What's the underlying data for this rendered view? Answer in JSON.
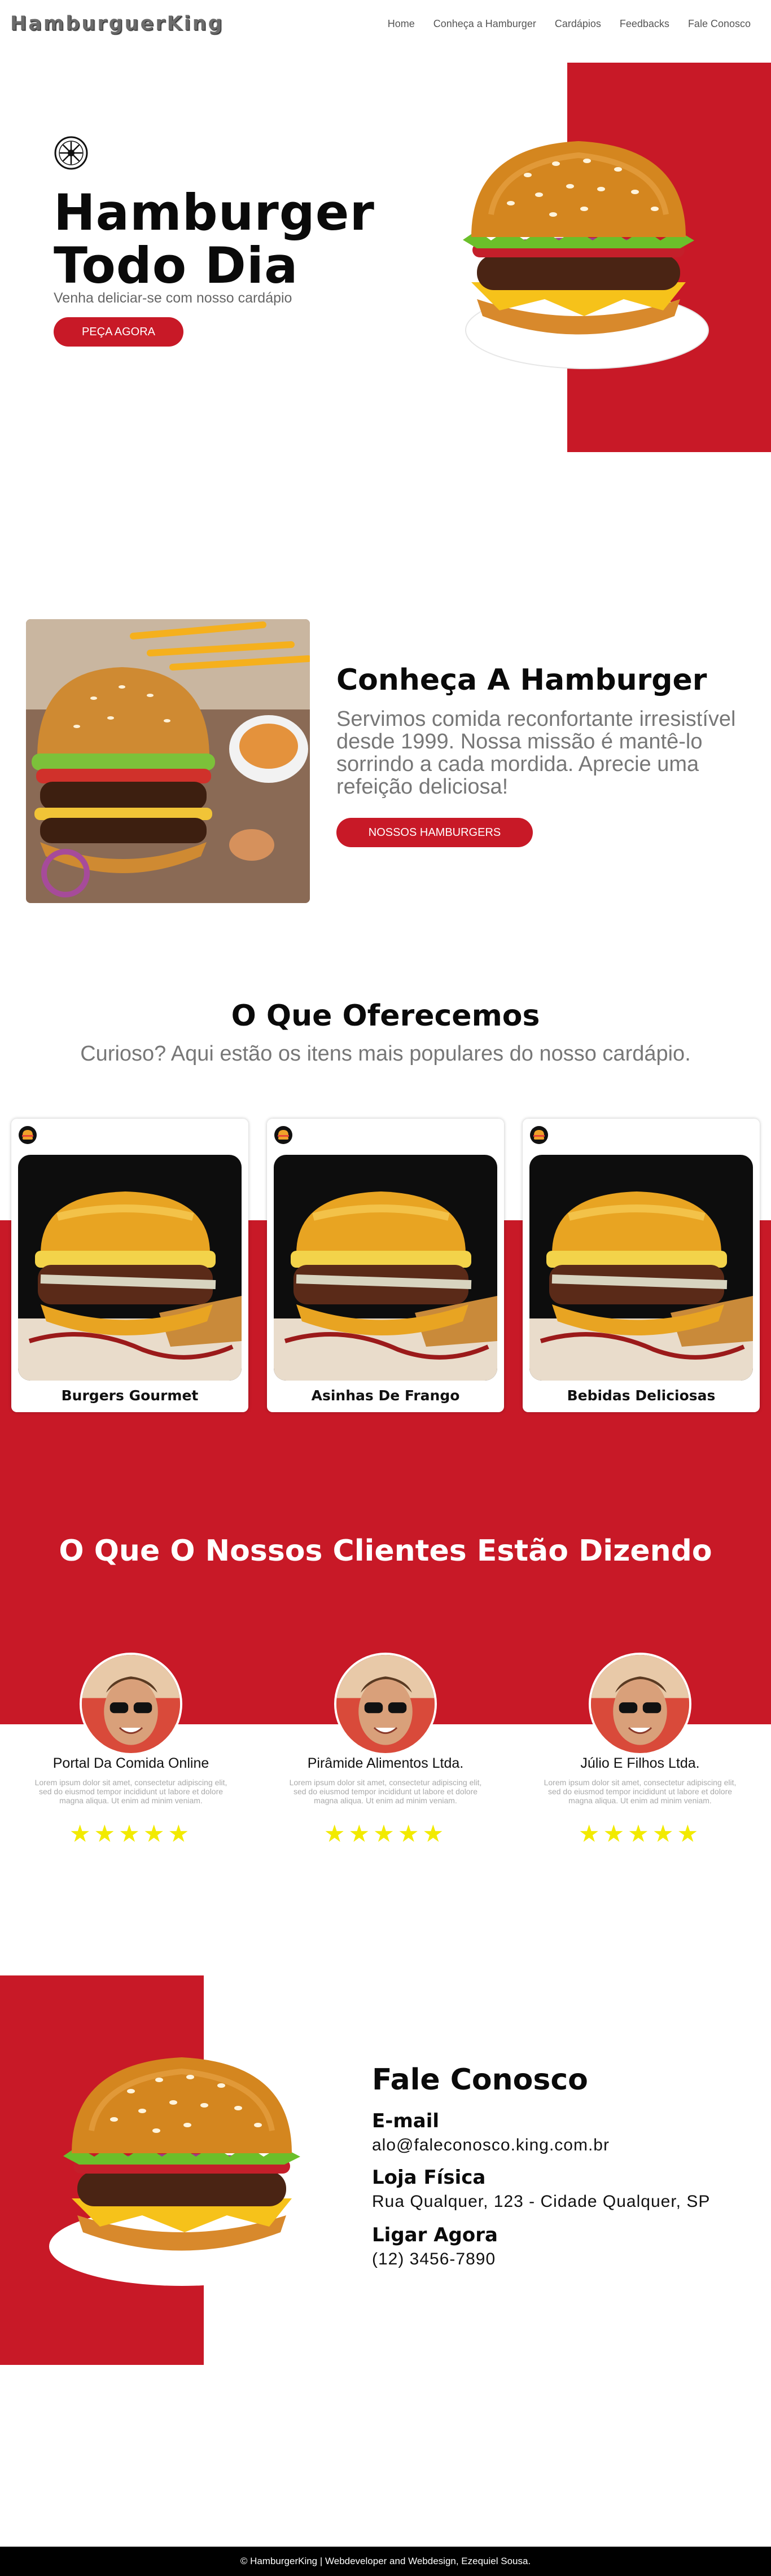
{
  "header": {
    "logo": "HamburguerKing",
    "nav": [
      "Home",
      "Conheça a Hamburger",
      "Cardápios",
      "Feedbacks",
      "Fale Conosco"
    ]
  },
  "hero": {
    "badge_icon": "emblem-icon",
    "title_line1": "Hamburger",
    "title_line2": "Todo Dia",
    "subtitle": "Venha deliciar-se com nosso cardápio",
    "cta": "PEÇA AGORA"
  },
  "about": {
    "title": "Conheça A Hamburger",
    "text": "Servimos comida reconfortante irresistível desde 1999. Nossa missão é mantê-lo sorrindo a cada mordida. Aprecie uma refeição deliciosa!",
    "cta": "NOSSOS HAMBURGERS"
  },
  "offer": {
    "title": "O Que Oferecemos",
    "subtitle": "Curioso? Aqui estão os itens mais populares do nosso cardápio.",
    "items": [
      {
        "label": "Burgers Gourmet",
        "icon": "burger-icon"
      },
      {
        "label": "Asinhas De Frango",
        "icon": "burger-icon"
      },
      {
        "label": "Bebidas Deliciosas",
        "icon": "burger-icon"
      }
    ]
  },
  "testimonials": {
    "title": "O Que O Nossos Clientes Estão Dizendo",
    "items": [
      {
        "name": "Portal Da Comida Online",
        "text": "Lorem ipsum dolor sit amet, consectetur adipiscing elit, sed do eiusmod tempor incididunt ut labore et dolore magna aliqua. Ut enim ad minim veniam.",
        "stars": "★★★★★"
      },
      {
        "name": "Pirâmide Alimentos Ltda.",
        "text": "Lorem ipsum dolor sit amet, consectetur adipiscing elit, sed do eiusmod tempor incididunt ut labore et dolore magna aliqua. Ut enim ad minim veniam.",
        "stars": "★★★★★"
      },
      {
        "name": "Júlio E Filhos Ltda.",
        "text": "Lorem ipsum dolor sit amet, consectetur adipiscing elit, sed do eiusmod tempor incididunt ut labore et dolore magna aliqua. Ut enim ad minim veniam.",
        "stars": "★★★★★"
      }
    ]
  },
  "contact": {
    "title": "Fale Conosco",
    "email_label": "E-mail",
    "email_value": "alo@faleconosco.king.com.br",
    "address_label": "Loja Física",
    "address_value": "Rua Qualquer, 123 - Cidade Qualquer, SP",
    "phone_label": "Ligar Agora",
    "phone_value": "(12) 3456-7890"
  },
  "footer": {
    "text": "© HamburgerKing | Webdeveloper and Webdesign, Ezequiel Sousa."
  },
  "colors": {
    "brand_red": "#c81927",
    "star_yellow": "#f2ea00",
    "footer_bg": "#000000"
  }
}
